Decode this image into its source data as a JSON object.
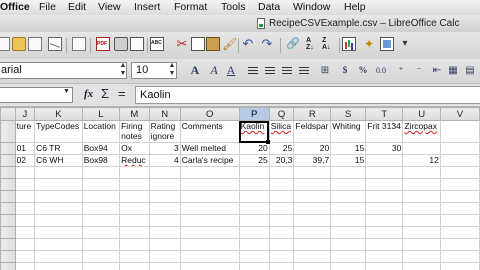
{
  "menubar": {
    "app_name": "Office",
    "items": [
      "File",
      "Edit",
      "View",
      "Insert",
      "Format",
      "Tools",
      "Data",
      "Window",
      "Help"
    ]
  },
  "window": {
    "title": "RecipeCSVExample.csv – LibreOffice Calc"
  },
  "toolbar": {
    "icons": [
      "new-document-icon",
      "open-folder-icon",
      "save-icon",
      "email-icon",
      "edit-file-icon",
      "export-pdf-icon",
      "print-icon",
      "print-preview-icon",
      "spellcheck-icon",
      "autospell-icon",
      "cut-icon",
      "copy-icon",
      "paste-icon",
      "clone-formatting-icon",
      "undo-icon",
      "redo-icon",
      "hyperlink-icon",
      "sort-ascending-icon",
      "sort-descending-icon",
      "insert-chart-icon",
      "navigator-icon",
      "gallery-icon",
      "more-icon"
    ]
  },
  "formatting": {
    "font_name": "arial",
    "font_size": "10"
  },
  "formula_bar": {
    "name_box": "",
    "fx_symbol": "fx",
    "sum_symbol": "Σ",
    "eq_symbol": "=",
    "content": "Kaolin"
  },
  "colors": {
    "selected_header": "#b8cbe6",
    "misspelling_underline": "#e02020"
  },
  "grid": {
    "columns": [
      "J",
      "K",
      "L",
      "M",
      "N",
      "O",
      "P",
      "Q",
      "R",
      "S",
      "T",
      "U",
      "V"
    ],
    "selected_column": "P",
    "rows": [
      {
        "row": "",
        "cells": [
          "ture",
          "TypeCodes",
          "Location",
          "Firing notes",
          "Rating ignore",
          "Comments",
          "Kaolin",
          "Silica",
          "Feldspar",
          "Whiting",
          "Frit 3134",
          "Zircopax",
          ""
        ]
      },
      {
        "row": "01",
        "cells": [
          "01",
          "C6 TR",
          "Box94",
          "Ox",
          "3",
          "Well melted",
          "20",
          "25",
          "20",
          "15",
          "30",
          "",
          ""
        ]
      },
      {
        "row": "02",
        "cells": [
          "02",
          "C6 WH",
          "Box98",
          "Reduc",
          "4",
          "Carla's recipe",
          "25",
          "20,3",
          "39,7",
          "15",
          "",
          "12",
          ""
        ]
      },
      {
        "row": "",
        "cells": [
          "",
          "",
          "",
          "",
          "",
          "",
          "",
          "",
          "",
          "",
          "",
          "",
          ""
        ]
      },
      {
        "row": "",
        "cells": [
          "",
          "",
          "",
          "",
          "",
          "",
          "",
          "",
          "",
          "",
          "",
          "",
          ""
        ]
      },
      {
        "row": "",
        "cells": [
          "",
          "",
          "",
          "",
          "",
          "",
          "",
          "",
          "",
          "",
          "",
          "",
          ""
        ]
      },
      {
        "row": "",
        "cells": [
          "",
          "",
          "",
          "",
          "",
          "",
          "",
          "",
          "",
          "",
          "",
          "",
          ""
        ]
      },
      {
        "row": "",
        "cells": [
          "",
          "",
          "",
          "",
          "",
          "",
          "",
          "",
          "",
          "",
          "",
          "",
          ""
        ]
      },
      {
        "row": "",
        "cells": [
          "",
          "",
          "",
          "",
          "",
          "",
          "",
          "",
          "",
          "",
          "",
          "",
          ""
        ]
      },
      {
        "row": "",
        "cells": [
          "",
          "",
          "",
          "",
          "",
          "",
          "",
          "",
          "",
          "",
          "",
          "",
          ""
        ]
      },
      {
        "row": "",
        "cells": [
          "",
          "",
          "",
          "",
          "",
          "",
          "",
          "",
          "",
          "",
          "",
          "",
          ""
        ]
      },
      {
        "row": "",
        "cells": [
          "",
          "",
          "",
          "",
          "",
          "",
          "",
          "",
          "",
          "",
          "",
          "",
          ""
        ]
      }
    ]
  }
}
